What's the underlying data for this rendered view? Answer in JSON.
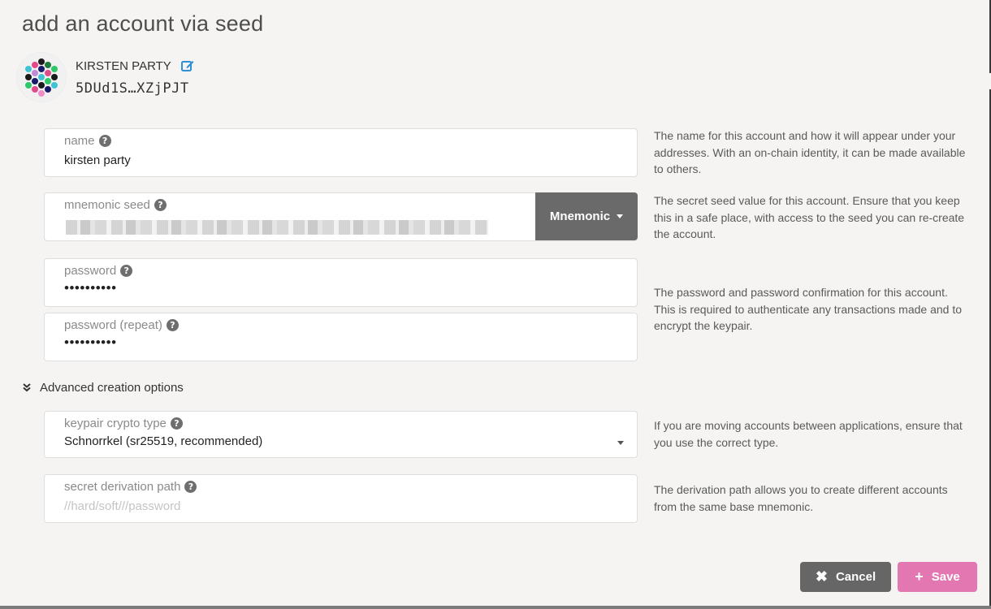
{
  "page": {
    "title": "add an account via seed"
  },
  "account": {
    "name": "KIRSTEN PARTY",
    "address": "5DUd1S…XZjPJT"
  },
  "fields": {
    "name": {
      "label": "name",
      "value": "kirsten party",
      "help": "The name for this account and how it will appear under your addresses. With an on-chain identity, it can be made available to others."
    },
    "seed": {
      "label": "mnemonic seed",
      "type_button": "Mnemonic",
      "help": "The secret seed value for this account. Ensure that you keep this in a safe place, with access to the seed you can re-create the account."
    },
    "password": {
      "label": "password",
      "value": "••••••••••"
    },
    "password_repeat": {
      "label": "password (repeat)",
      "value": "••••••••••"
    },
    "password_help": "The password and password confirmation for this account. This is required to authenticate any transactions made and to encrypt the keypair.",
    "crypto": {
      "label": "keypair crypto type",
      "value": "Schnorrkel (sr25519, recommended)",
      "help": "If you are moving accounts between applications, ensure that you use the correct type."
    },
    "derivation": {
      "label": "secret derivation path",
      "placeholder": "//hard/soft///password",
      "help": "The derivation path allows you to create different accounts from the same base mnemonic."
    }
  },
  "advanced": {
    "label": "Advanced creation options"
  },
  "actions": {
    "cancel": "Cancel",
    "save": "Save"
  },
  "icons": {
    "help": "question-circle-icon",
    "edit": "edit-icon",
    "cancel": "close-icon",
    "save": "plus-icon",
    "advanced": "double-chevron-down-icon"
  },
  "colors": {
    "accent": "#e377b2",
    "edit": "#2d8fd5",
    "button_dark": "#666666"
  }
}
